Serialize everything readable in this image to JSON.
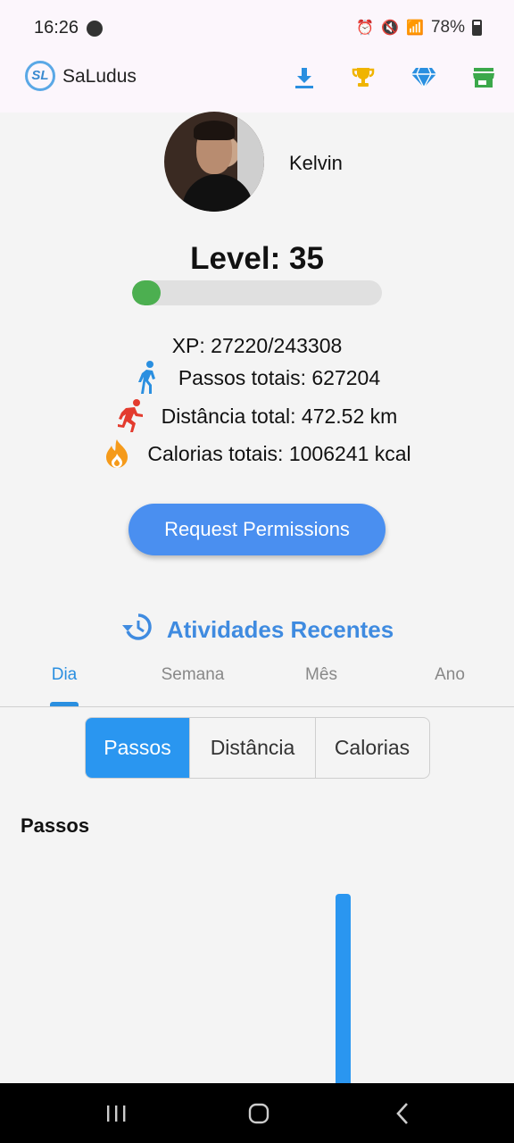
{
  "status_bar": {
    "time": "16:26",
    "battery": "78%"
  },
  "app_bar": {
    "logo_text": "SL",
    "title": "SaLudus",
    "actions": [
      "download-icon",
      "trophy-icon",
      "diamond-icon",
      "store-icon"
    ]
  },
  "profile": {
    "username": "Kelvin",
    "level": "Level: 35",
    "level_progress": 0.113
  },
  "stats": {
    "xp": "XP: 27220/243308",
    "steps": "Passos totais: 627204",
    "distance": "Distância total: 472.52 km",
    "calories": "Calorias totais: 1006241 kcal"
  },
  "request_button": "Request Permissions",
  "recent": {
    "title": "Atividades Recentes"
  },
  "tabs": [
    {
      "label": "Dia"
    },
    {
      "label": "Semana"
    },
    {
      "label": "Mês"
    },
    {
      "label": "Ano"
    }
  ],
  "segments": [
    {
      "label": "Passos"
    },
    {
      "label": "Distância"
    },
    {
      "label": "Calorias"
    }
  ],
  "chart_title": "Passos",
  "colors": {
    "accent": "#2a96f0",
    "progress": "#4caf50",
    "download": "#2a8fe0",
    "trophy": "#f0b400",
    "diamond": "#2a8fe0",
    "store": "#3ba84a",
    "walk": "#2a8fe0",
    "run": "#e33b2e",
    "fire": "#f59a1a"
  }
}
